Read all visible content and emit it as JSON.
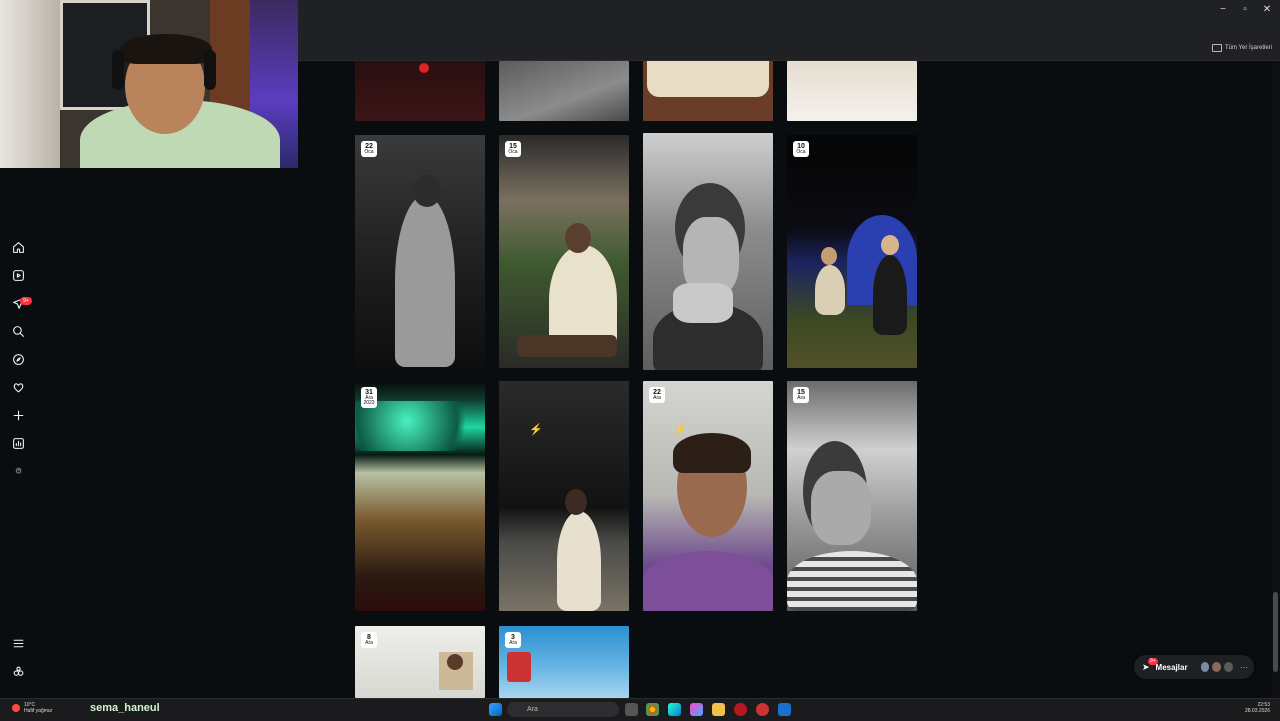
{
  "browser": {
    "window_controls": [
      "−",
      "▫",
      "✕"
    ],
    "bookmarks_folder_label": "Tüm Yer İşaretleri",
    "toolbar_icons": [
      "install-icon",
      "star-icon",
      "extensions-icon",
      "sidepanel-icon",
      "profile-icon",
      "menu-icon"
    ]
  },
  "sidebar": {
    "items": [
      {
        "name": "home-icon"
      },
      {
        "name": "reels-icon"
      },
      {
        "name": "messages-icon",
        "badge": "9+"
      },
      {
        "name": "search-icon"
      },
      {
        "name": "explore-icon"
      },
      {
        "name": "notifications-icon"
      },
      {
        "name": "create-icon"
      },
      {
        "name": "dashboard-icon"
      },
      {
        "name": "threads-icon"
      }
    ],
    "more_icon": "menu-icon",
    "meta_icon": "meta-icon"
  },
  "grid": {
    "tiles": [
      {
        "day": "",
        "month": "",
        "year": "",
        "variant": "dark-red"
      },
      {
        "day": "",
        "month": "",
        "year": "",
        "variant": "bw-ground"
      },
      {
        "day": "",
        "month": "",
        "year": "",
        "variant": "brown-person"
      },
      {
        "day": "",
        "month": "",
        "year": "",
        "variant": "white-table"
      },
      {
        "day": "22",
        "month": "Oca",
        "year": "",
        "variant": "bw-couple"
      },
      {
        "day": "15",
        "month": "Oca",
        "year": "",
        "variant": "terrace"
      },
      {
        "day": "",
        "month": "",
        "year": "",
        "variant": "bw-smoke"
      },
      {
        "day": "10",
        "month": "Oca",
        "year": "",
        "variant": "camp"
      },
      {
        "day": "31",
        "month": "Ara",
        "year": "2023",
        "variant": "green-tree"
      },
      {
        "day": "",
        "month": "",
        "year": "",
        "variant": "night-beach"
      },
      {
        "day": "22",
        "month": "Ara",
        "year": "",
        "variant": "purple-hoodie"
      },
      {
        "day": "15",
        "month": "Ara",
        "year": "",
        "variant": "bw-portrait"
      },
      {
        "day": "8",
        "month": "Ara",
        "year": "",
        "variant": "white-poster"
      },
      {
        "day": "3",
        "month": "Ara",
        "year": "",
        "variant": "sky"
      }
    ]
  },
  "messages": {
    "label": "Mesajlar",
    "badge": "9+"
  },
  "taskbar": {
    "weather_temp": "10°C",
    "weather_desc": "Hafif yağmur",
    "streamer_name": "sema_haneul",
    "search_placeholder": "Ara",
    "time": "22:53",
    "date": "28.03.2026"
  },
  "colors": {
    "page_bg": "#0a0d0f",
    "badge": "#ff3040",
    "chrome": "#202124"
  }
}
